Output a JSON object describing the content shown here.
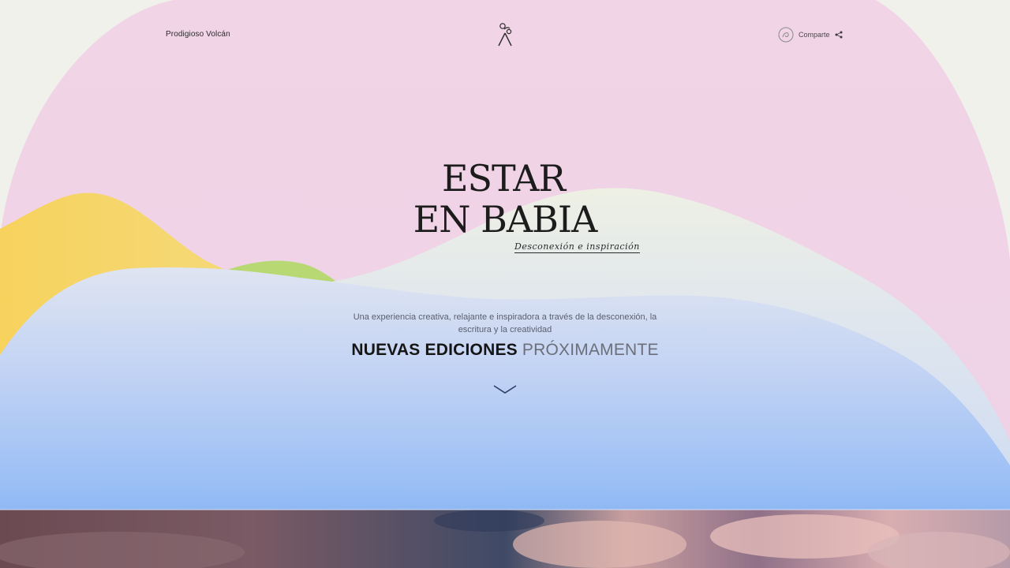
{
  "header": {
    "brand": "Prodigioso Volcán",
    "share_label": "Comparte"
  },
  "hero": {
    "title_line1": "ESTAR",
    "title_line2": "EN BABIA",
    "tagline": "Desconexión e inspiración",
    "description": "Una experiencia creativa, relajante e inspiradora a través de la desconexión, la escritura y la creatividad",
    "editions_bold": "NUEVAS EDICIONES",
    "editions_light": "PRÓXIMAMENTE"
  },
  "colors": {
    "background": "#f1f1ec",
    "pink": "#f0d3e6",
    "yellow": "#f8d469",
    "green": "#b6d86e",
    "blue": "#7fb0f3",
    "text_dark": "#1c1c1c"
  },
  "icons": {
    "logo": "figure-logo-icon",
    "share_circle": "spiral-circle-icon",
    "share": "share-icon",
    "scroll": "chevron-down-icon"
  }
}
